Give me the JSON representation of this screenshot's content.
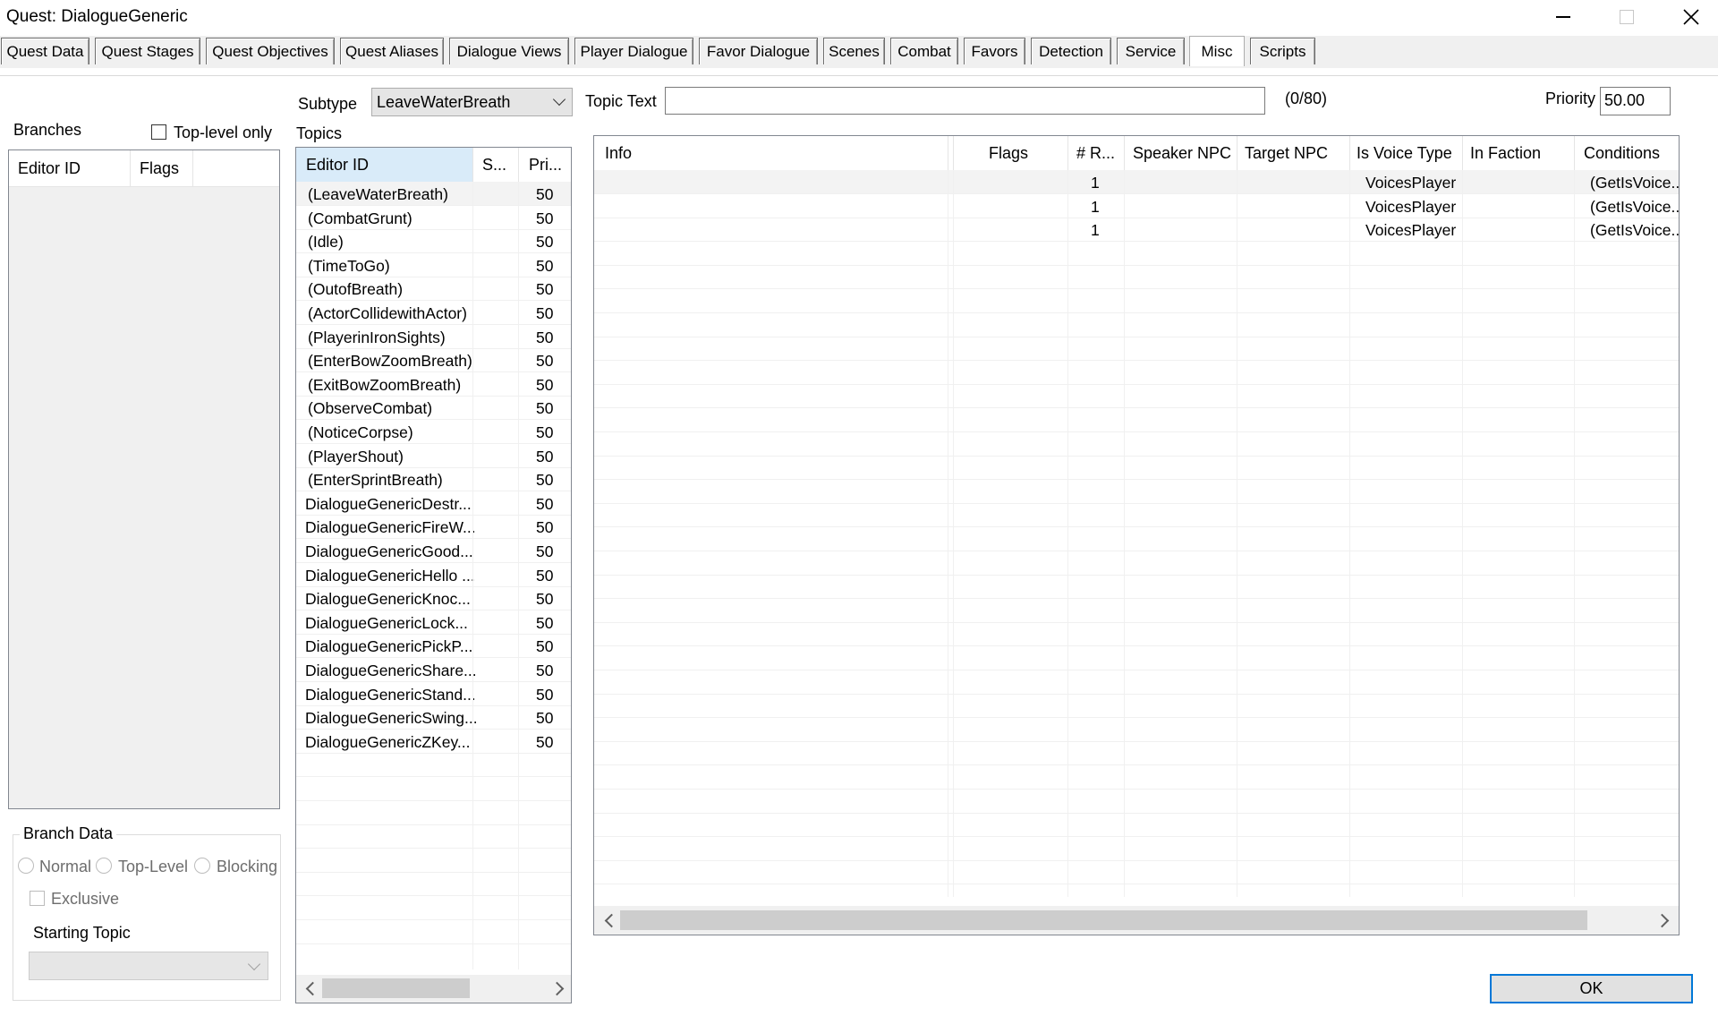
{
  "window": {
    "title": "Quest: DialogueGeneric"
  },
  "tabs": [
    {
      "label": "Quest Data"
    },
    {
      "label": "Quest Stages"
    },
    {
      "label": "Quest Objectives"
    },
    {
      "label": "Quest Aliases"
    },
    {
      "label": "Dialogue Views"
    },
    {
      "label": "Player Dialogue"
    },
    {
      "label": "Favor Dialogue"
    },
    {
      "label": "Scenes"
    },
    {
      "label": "Combat"
    },
    {
      "label": "Favors"
    },
    {
      "label": "Detection"
    },
    {
      "label": "Service"
    },
    {
      "label": "Misc"
    },
    {
      "label": "Scripts"
    }
  ],
  "active_tab": "Misc",
  "branches": {
    "label": "Branches",
    "top_level_only_label": "Top-level only",
    "columns": [
      "Editor ID",
      "Flags"
    ]
  },
  "branch_data": {
    "title": "Branch Data",
    "normal_label": "Normal",
    "top_level_label": "Top-Level",
    "blocking_label": "Blocking",
    "exclusive_label": "Exclusive",
    "starting_topic_label": "Starting Topic"
  },
  "subtype": {
    "label": "Subtype",
    "value": "LeaveWaterBreath"
  },
  "topics": {
    "label": "Topics",
    "columns": [
      "Editor ID",
      "S...",
      "Pri..."
    ],
    "rows": [
      {
        "id": "(LeaveWaterBreath)",
        "pri": "50"
      },
      {
        "id": "(CombatGrunt)",
        "pri": "50"
      },
      {
        "id": "(Idle)",
        "pri": "50"
      },
      {
        "id": "(TimeToGo)",
        "pri": "50"
      },
      {
        "id": "(OutofBreath)",
        "pri": "50"
      },
      {
        "id": "(ActorCollidewithActor)",
        "pri": "50"
      },
      {
        "id": "(PlayerinIronSights)",
        "pri": "50"
      },
      {
        "id": "(EnterBowZoomBreath)",
        "pri": "50"
      },
      {
        "id": "(ExitBowZoomBreath)",
        "pri": "50"
      },
      {
        "id": "(ObserveCombat)",
        "pri": "50"
      },
      {
        "id": "(NoticeCorpse)",
        "pri": "50"
      },
      {
        "id": "(PlayerShout)",
        "pri": "50"
      },
      {
        "id": "(EnterSprintBreath)",
        "pri": "50"
      },
      {
        "id": "DialogueGenericDestr...",
        "pri": "50"
      },
      {
        "id": "DialogueGenericFireW...",
        "pri": "50"
      },
      {
        "id": "DialogueGenericGood...",
        "pri": "50"
      },
      {
        "id": "DialogueGenericHello ...",
        "pri": "50"
      },
      {
        "id": "DialogueGenericKnoc...",
        "pri": "50"
      },
      {
        "id": "DialogueGenericLock...",
        "pri": "50"
      },
      {
        "id": "DialogueGenericPickP...",
        "pri": "50"
      },
      {
        "id": "DialogueGenericShare...",
        "pri": "50"
      },
      {
        "id": "DialogueGenericStand...",
        "pri": "50"
      },
      {
        "id": "DialogueGenericSwing...",
        "pri": "50"
      },
      {
        "id": "DialogueGenericZKey...",
        "pri": "50"
      }
    ]
  },
  "topic_text": {
    "label": "Topic Text",
    "value": "",
    "counter": "(0/80)"
  },
  "priority": {
    "label": "Priority",
    "value": "50.00"
  },
  "info": {
    "columns": [
      "Info",
      "Flags",
      "# R...",
      "Speaker NPC",
      "Target NPC",
      "Is Voice Type",
      "In Faction",
      "Conditions"
    ],
    "rows": [
      {
        "info": "",
        "flags": "",
        "r": "1",
        "speaker": "",
        "target": "",
        "voice": "VoicesPlayer",
        "faction": "",
        "conditions": "(GetIsVoice..."
      },
      {
        "info": "",
        "flags": "",
        "r": "1",
        "speaker": "",
        "target": "",
        "voice": "VoicesPlayer",
        "faction": "",
        "conditions": "(GetIsVoice..."
      },
      {
        "info": "",
        "flags": "",
        "r": "1",
        "speaker": "",
        "target": "",
        "voice": "VoicesPlayer",
        "faction": "",
        "conditions": "(GetIsVoice..."
      }
    ]
  },
  "ok_label": "OK"
}
